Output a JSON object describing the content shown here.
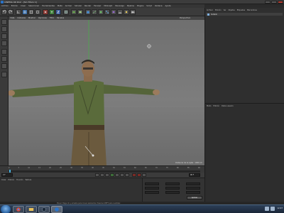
{
  "window": {
    "title": "CINEMA 4D R12 - [Sin Título 1]"
  },
  "menubar": {
    "items": [
      "Archivo",
      "Edición",
      "Crear",
      "Seleccionar",
      "Herramientas",
      "Malla",
      "Animar",
      "Simular",
      "Render",
      "Esculpir",
      "MoGraph",
      "Personaje",
      "Pipeline",
      "Plugins",
      "Script",
      "Ventana",
      "Ayuda"
    ]
  },
  "viewport": {
    "menu": [
      "Vista",
      "Cámaras",
      "Mostrar",
      "Opciones",
      "Filtro",
      "Paneles"
    ],
    "title": "Perspectiva",
    "info": "Distancia de la rejilla : 1000 cm"
  },
  "object_manager": {
    "menu": [
      "Archivo",
      "Edición",
      "Ver",
      "Objetos",
      "Etiquetas",
      "Marcadores"
    ],
    "object_name": "Soldado"
  },
  "attributes": {
    "menu": [
      "Modo",
      "Edición",
      "Datos usuario"
    ]
  },
  "timeline": {
    "ticks": [
      "0",
      "5",
      "10",
      "15",
      "20",
      "25",
      "30",
      "35",
      "40",
      "45",
      "50",
      "55",
      "60",
      "65",
      "70",
      "75",
      "80",
      "85",
      "90"
    ]
  },
  "transport": {
    "start_frame": "0 F",
    "end_frame": "90 F"
  },
  "materials": {
    "menu": [
      "Crear",
      "Edición",
      "Función",
      "Textura"
    ]
  },
  "coordinates": {
    "apply_label": "Aplicar"
  },
  "statusbar": {
    "text": "Mover: Haga clic y arrastre para mover elementos. Presione SHIFT para cuantizar."
  },
  "taskbar": {
    "clock": "12:47"
  },
  "colors": {
    "accent": "#46b2e0",
    "record": "#7a2b26"
  },
  "icons": [
    "undo-icon",
    "redo-icon",
    "live-select-icon",
    "move-icon",
    "scale-icon",
    "rotate-icon",
    "x-axis-icon",
    "y-axis-icon",
    "z-axis-icon",
    "world-icon",
    "render-view-icon",
    "render-icon",
    "cube-icon",
    "spline-icon",
    "nurbs-icon",
    "array-icon",
    "deformer-icon",
    "scene-icon",
    "light-icon",
    "camera-icon"
  ]
}
